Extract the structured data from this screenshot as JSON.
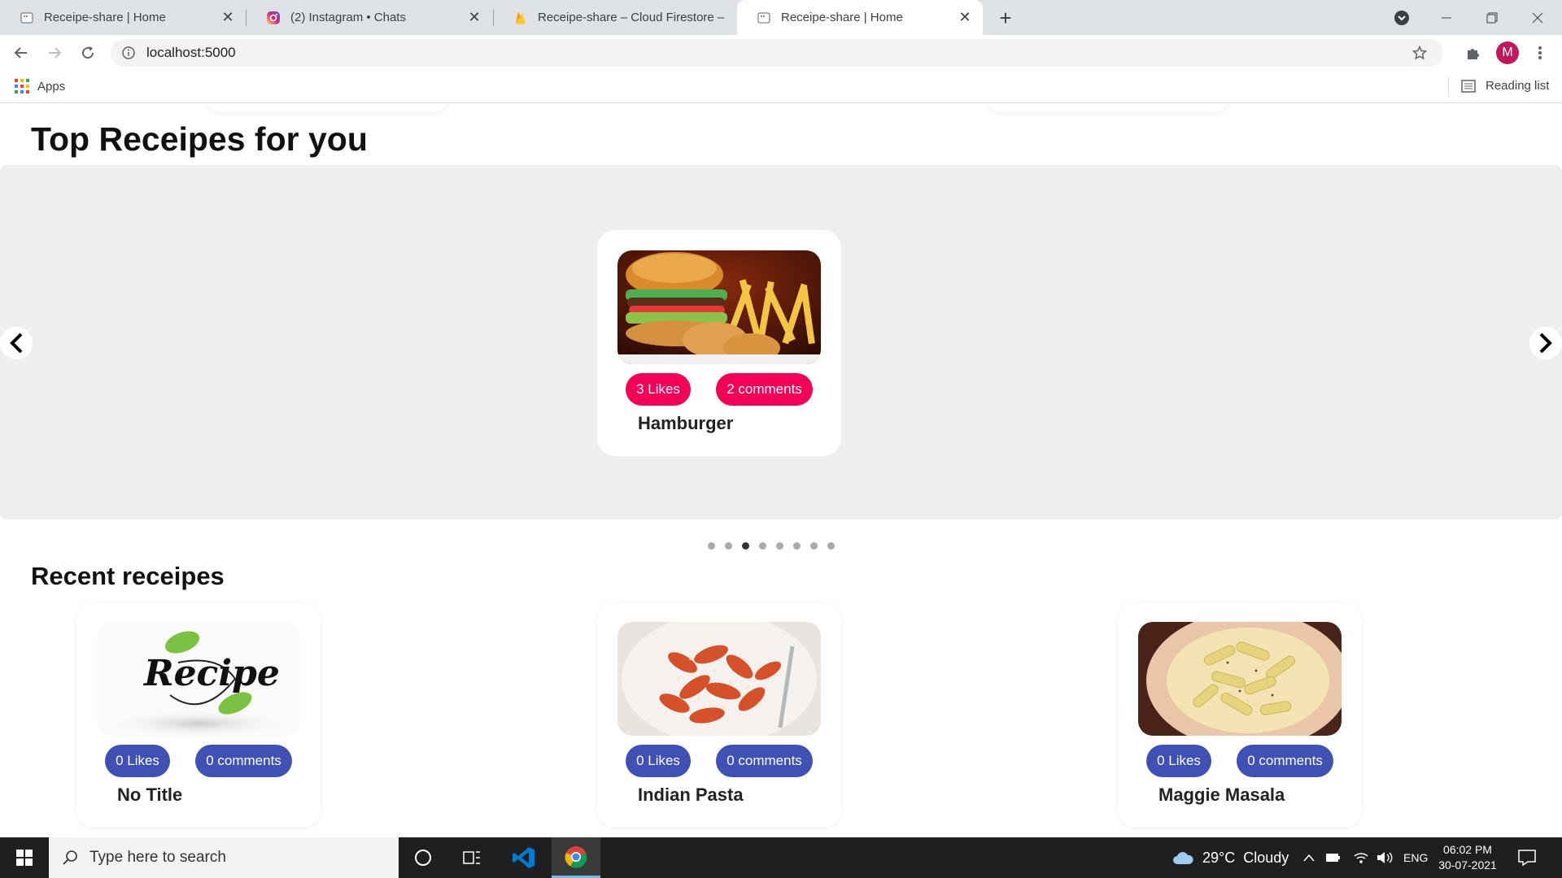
{
  "browser": {
    "tabs": [
      {
        "title": "Receipe-share | Home",
        "icon": "page-favicon",
        "active": false
      },
      {
        "title": "(2) Instagram • Chats",
        "icon": "instagram-favicon",
        "active": false
      },
      {
        "title": "Receipe-share – Cloud Firestore –",
        "icon": "firebase-favicon",
        "active": false
      },
      {
        "title": "Receipe-share | Home",
        "icon": "page-favicon",
        "active": true
      }
    ],
    "url": "localhost:5000",
    "profile_initial": "M",
    "bookmarks": {
      "apps_label": "Apps",
      "reading_list_label": "Reading list"
    }
  },
  "page": {
    "top_title": "Top Receipes for you",
    "featured": {
      "likes": "3 Likes",
      "comments": "2 comments",
      "name": "Hamburger",
      "image": "hamburger-fries-photo"
    },
    "carousel": {
      "slide_count": 8,
      "active_index": 2
    },
    "recent_title": "Recent receipes",
    "recent": [
      {
        "likes": "0 Likes",
        "comments": "0 comments",
        "name": "No Title",
        "image": "recipe-logo"
      },
      {
        "likes": "0 Likes",
        "comments": "0 comments",
        "name": "Indian Pasta",
        "image": "red-pasta-photo"
      },
      {
        "likes": "0 Likes",
        "comments": "0 comments",
        "name": "Maggie Masala",
        "image": "white-sauce-pasta-photo"
      }
    ],
    "recipe_logo_text": "Recipe",
    "colors": {
      "likes_featured": "#f50057",
      "likes_recent": "#3f51b5",
      "carousel_bg": "#eeeeee"
    }
  },
  "taskbar": {
    "search_placeholder": "Type here to search",
    "weather": "29°C  Cloudy",
    "language": "ENG",
    "time": "06:02 PM",
    "date": "30-07-2021"
  }
}
